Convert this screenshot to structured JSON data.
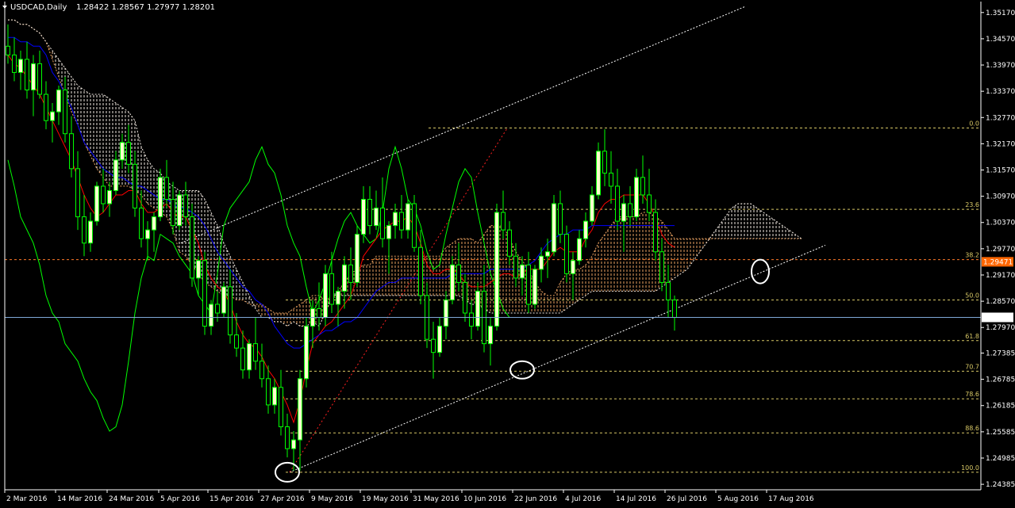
{
  "header": {
    "symbol": "USDCAD,Daily",
    "ohlc": "1.28422 1.28567 1.27977 1.28201"
  },
  "colors": {
    "background": "#000000",
    "bull_candle": "#ffffcc",
    "bear_candle": "#000000",
    "wick": "#00ff00",
    "tenkan": "#ff0000",
    "kijun": "#0000ff",
    "chikou": "#00ff00",
    "cloud": "#e8a060",
    "fib_line": "#d8c866",
    "trendline": "#ffffff",
    "current_price_bg": "#ffffff",
    "marker_price_bg": "#ff6600"
  },
  "chart_data": {
    "type": "candlestick",
    "title": "USDCAD,Daily",
    "price_axis_ticks": [
      "1.35170",
      "1.34570",
      "1.33970",
      "1.33370",
      "1.32770",
      "1.32170",
      "1.31570",
      "1.30970",
      "1.30370",
      "1.29770",
      "1.29170",
      "1.28570",
      "1.27970",
      "1.27385",
      "1.26785",
      "1.26185",
      "1.25585",
      "1.24985",
      "1.24385"
    ],
    "date_axis_ticks": [
      "2 Mar 2016",
      "14 Mar 2016",
      "24 Mar 2016",
      "5 Apr 2016",
      "15 Apr 2016",
      "27 Apr 2016",
      "9 May 2016",
      "19 May 2016",
      "31 May 2016",
      "10 Jun 2016",
      "22 Jun 2016",
      "4 Jul 2016",
      "14 Jul 2016",
      "26 Jul 2016",
      "5 Aug 2016",
      "17 Aug 2016"
    ],
    "ylim": [
      1.2426,
      1.3542
    ],
    "current_price": "1.28201",
    "marker_price": "1.29471",
    "fibonacci": {
      "high": 1.3253,
      "low": 1.2466,
      "levels": [
        {
          "label": "0.0",
          "value": 1.3253
        },
        {
          "label": "23.6",
          "value": 1.3067
        },
        {
          "label": "38.2",
          "value": 1.2952
        },
        {
          "label": "50.0",
          "value": 1.286
        },
        {
          "label": "61.8",
          "value": 1.2767
        },
        {
          "label": "70.7",
          "value": 1.2697
        },
        {
          "label": "78.6",
          "value": 1.2634
        },
        {
          "label": "88.6",
          "value": 1.2556
        },
        {
          "label": "100.0",
          "value": 1.2466
        }
      ]
    },
    "ohlc": [
      [
        1.344,
        1.349,
        1.34,
        1.342
      ],
      [
        1.342,
        1.346,
        1.336,
        1.338
      ],
      [
        1.338,
        1.343,
        1.334,
        1.341
      ],
      [
        1.341,
        1.345,
        1.332,
        1.334
      ],
      [
        1.334,
        1.342,
        1.328,
        1.34
      ],
      [
        1.34,
        1.343,
        1.332,
        1.333
      ],
      [
        1.333,
        1.336,
        1.325,
        1.327
      ],
      [
        1.327,
        1.331,
        1.322,
        1.329
      ],
      [
        1.329,
        1.335,
        1.326,
        1.334
      ],
      [
        1.334,
        1.337,
        1.322,
        1.324
      ],
      [
        1.324,
        1.328,
        1.314,
        1.316
      ],
      [
        1.316,
        1.32,
        1.302,
        1.305
      ],
      [
        1.305,
        1.31,
        1.296,
        1.299
      ],
      [
        1.299,
        1.306,
        1.297,
        1.304
      ],
      [
        1.304,
        1.313,
        1.303,
        1.312
      ],
      [
        1.312,
        1.316,
        1.306,
        1.308
      ],
      [
        1.308,
        1.313,
        1.305,
        1.311
      ],
      [
        1.311,
        1.32,
        1.31,
        1.318
      ],
      [
        1.318,
        1.324,
        1.316,
        1.322
      ],
      [
        1.322,
        1.326,
        1.315,
        1.317
      ],
      [
        1.317,
        1.32,
        1.305,
        1.307
      ],
      [
        1.307,
        1.311,
        1.298,
        1.3
      ],
      [
        1.3,
        1.304,
        1.295,
        1.302
      ],
      [
        1.302,
        1.306,
        1.297,
        1.305
      ],
      [
        1.305,
        1.316,
        1.304,
        1.314
      ],
      [
        1.314,
        1.318,
        1.307,
        1.309
      ],
      [
        1.309,
        1.313,
        1.301,
        1.303
      ],
      [
        1.303,
        1.311,
        1.302,
        1.31
      ],
      [
        1.31,
        1.313,
        1.303,
        1.305
      ],
      [
        1.305,
        1.308,
        1.289,
        1.291
      ],
      [
        1.291,
        1.296,
        1.287,
        1.295
      ],
      [
        1.295,
        1.297,
        1.278,
        1.28
      ],
      [
        1.28,
        1.286,
        1.278,
        1.285
      ],
      [
        1.285,
        1.288,
        1.281,
        1.283
      ],
      [
        1.283,
        1.29,
        1.282,
        1.289
      ],
      [
        1.289,
        1.293,
        1.276,
        1.278
      ],
      [
        1.278,
        1.283,
        1.273,
        1.275
      ],
      [
        1.275,
        1.279,
        1.268,
        1.27
      ],
      [
        1.27,
        1.277,
        1.268,
        1.276
      ],
      [
        1.276,
        1.282,
        1.27,
        1.272
      ],
      [
        1.272,
        1.276,
        1.266,
        1.268
      ],
      [
        1.268,
        1.271,
        1.26,
        1.262
      ],
      [
        1.262,
        1.268,
        1.26,
        1.266
      ],
      [
        1.266,
        1.27,
        1.255,
        1.257
      ],
      [
        1.257,
        1.26,
        1.25,
        1.252
      ],
      [
        1.252,
        1.256,
        1.247,
        1.254
      ],
      [
        1.254,
        1.27,
        1.247,
        1.268
      ],
      [
        1.268,
        1.282,
        1.266,
        1.28
      ],
      [
        1.28,
        1.286,
        1.275,
        1.284
      ],
      [
        1.284,
        1.29,
        1.279,
        1.282
      ],
      [
        1.282,
        1.294,
        1.28,
        1.292
      ],
      [
        1.292,
        1.297,
        1.283,
        1.285
      ],
      [
        1.285,
        1.289,
        1.28,
        1.288
      ],
      [
        1.288,
        1.296,
        1.284,
        1.294
      ],
      [
        1.294,
        1.298,
        1.286,
        1.29
      ],
      [
        1.29,
        1.303,
        1.289,
        1.301
      ],
      [
        1.301,
        1.312,
        1.299,
        1.309
      ],
      [
        1.309,
        1.312,
        1.301,
        1.303
      ],
      [
        1.303,
        1.311,
        1.302,
        1.307
      ],
      [
        1.307,
        1.314,
        1.298,
        1.3
      ],
      [
        1.3,
        1.304,
        1.292,
        1.303
      ],
      [
        1.303,
        1.308,
        1.3,
        1.306
      ],
      [
        1.306,
        1.31,
        1.3,
        1.302
      ],
      [
        1.302,
        1.309,
        1.3,
        1.308
      ],
      [
        1.308,
        1.31,
        1.297,
        1.298
      ],
      [
        1.298,
        1.302,
        1.285,
        1.287
      ],
      [
        1.287,
        1.29,
        1.275,
        1.277
      ],
      [
        1.277,
        1.281,
        1.268,
        1.274
      ],
      [
        1.274,
        1.282,
        1.273,
        1.28
      ],
      [
        1.28,
        1.288,
        1.277,
        1.286
      ],
      [
        1.286,
        1.296,
        1.285,
        1.294
      ],
      [
        1.294,
        1.299,
        1.288,
        1.29
      ],
      [
        1.29,
        1.292,
        1.281,
        1.283
      ],
      [
        1.283,
        1.286,
        1.277,
        1.28
      ],
      [
        1.28,
        1.29,
        1.279,
        1.288
      ],
      [
        1.288,
        1.294,
        1.274,
        1.276
      ],
      [
        1.276,
        1.282,
        1.271,
        1.28
      ],
      [
        1.28,
        1.308,
        1.279,
        1.306
      ],
      [
        1.306,
        1.311,
        1.3,
        1.302
      ],
      [
        1.302,
        1.304,
        1.294,
        1.296
      ],
      [
        1.296,
        1.299,
        1.289,
        1.291
      ],
      [
        1.291,
        1.296,
        1.287,
        1.294
      ],
      [
        1.294,
        1.297,
        1.283,
        1.285
      ],
      [
        1.285,
        1.294,
        1.284,
        1.293
      ],
      [
        1.293,
        1.298,
        1.29,
        1.296
      ],
      [
        1.296,
        1.3,
        1.291,
        1.297
      ],
      [
        1.297,
        1.31,
        1.296,
        1.308
      ],
      [
        1.308,
        1.311,
        1.299,
        1.301
      ],
      [
        1.301,
        1.303,
        1.29,
        1.292
      ],
      [
        1.292,
        1.297,
        1.286,
        1.295
      ],
      [
        1.295,
        1.302,
        1.294,
        1.3
      ],
      [
        1.3,
        1.306,
        1.298,
        1.304
      ],
      [
        1.304,
        1.312,
        1.303,
        1.31
      ],
      [
        1.31,
        1.322,
        1.309,
        1.32
      ],
      [
        1.32,
        1.325,
        1.312,
        1.315
      ],
      [
        1.315,
        1.32,
        1.308,
        1.312
      ],
      [
        1.312,
        1.316,
        1.302,
        1.304
      ],
      [
        1.304,
        1.31,
        1.297,
        1.308
      ],
      [
        1.308,
        1.312,
        1.303,
        1.305
      ],
      [
        1.305,
        1.316,
        1.304,
        1.314
      ],
      [
        1.314,
        1.319,
        1.308,
        1.31
      ],
      [
        1.31,
        1.316,
        1.304,
        1.306
      ],
      [
        1.306,
        1.309,
        1.295,
        1.297
      ],
      [
        1.297,
        1.3,
        1.288,
        1.29
      ],
      [
        1.29,
        1.294,
        1.282,
        1.286
      ],
      [
        1.286,
        1.287,
        1.279,
        1.282
      ]
    ],
    "tenkan_sen": [
      1.342,
      1.34,
      1.339,
      1.337,
      1.335,
      1.333,
      1.33,
      1.327,
      1.324,
      1.321,
      1.318,
      1.314,
      1.31,
      1.307,
      1.305,
      1.306,
      1.308,
      1.31,
      1.31,
      1.311,
      1.311,
      1.308,
      1.306,
      1.306,
      1.307,
      1.308,
      1.306,
      1.305,
      1.305,
      1.302,
      1.299,
      1.294,
      1.291,
      1.289,
      1.288,
      1.285,
      1.281,
      1.278,
      1.276,
      1.275,
      1.273,
      1.27,
      1.268,
      1.265,
      1.262,
      1.258,
      1.263,
      1.27,
      1.276,
      1.278,
      1.28,
      1.281,
      1.283,
      1.285,
      1.287,
      1.291,
      1.296,
      1.298,
      1.3,
      1.302,
      1.303,
      1.304,
      1.304,
      1.305,
      1.303,
      1.299,
      1.294,
      1.292,
      1.292,
      1.293,
      1.293,
      1.292,
      1.29,
      1.289,
      1.289,
      1.289,
      1.29,
      1.291,
      1.292,
      1.292,
      1.291,
      1.292,
      1.293,
      1.293,
      1.293,
      1.295,
      1.297,
      1.298,
      1.297,
      1.297,
      1.297,
      1.3,
      1.302,
      1.306,
      1.308,
      1.309,
      1.309,
      1.31,
      1.31,
      1.31,
      1.31,
      1.308,
      1.305,
      1.301,
      1.299,
      1.298
    ],
    "kijun_sen": [
      1.346,
      1.346,
      1.345,
      1.345,
      1.344,
      1.344,
      1.342,
      1.338,
      1.336,
      1.333,
      1.33,
      1.326,
      1.322,
      1.32,
      1.318,
      1.316,
      1.315,
      1.314,
      1.314,
      1.313,
      1.312,
      1.312,
      1.311,
      1.31,
      1.309,
      1.309,
      1.308,
      1.307,
      1.307,
      1.306,
      1.305,
      1.303,
      1.3,
      1.297,
      1.295,
      1.293,
      1.291,
      1.289,
      1.288,
      1.286,
      1.285,
      1.283,
      1.28,
      1.278,
      1.276,
      1.275,
      1.275,
      1.276,
      1.277,
      1.278,
      1.279,
      1.279,
      1.28,
      1.281,
      1.281,
      1.282,
      1.284,
      1.286,
      1.288,
      1.289,
      1.29,
      1.29,
      1.291,
      1.291,
      1.291,
      1.291,
      1.291,
      1.291,
      1.291,
      1.291,
      1.292,
      1.292,
      1.292,
      1.292,
      1.292,
      1.292,
      1.293,
      1.293,
      1.293,
      1.293,
      1.293,
      1.293,
      1.294,
      1.295,
      1.297,
      1.299,
      1.3,
      1.301,
      1.301,
      1.302,
      1.302,
      1.302,
      1.303,
      1.303,
      1.303,
      1.303,
      1.303,
      1.303,
      1.303,
      1.303,
      1.303,
      1.303,
      1.303,
      1.303,
      1.303,
      1.303
    ],
    "chikou_span": [
      1.318,
      1.312,
      1.305,
      1.302,
      1.299,
      1.294,
      1.287,
      1.283,
      1.281,
      1.276,
      1.274,
      1.272,
      1.268,
      1.265,
      1.263,
      1.259,
      1.256,
      1.257,
      1.262,
      1.272,
      1.283,
      1.291,
      1.296,
      1.295,
      1.301,
      1.3,
      1.299,
      1.296,
      1.294,
      1.292,
      1.287,
      1.285,
      1.283,
      1.292,
      1.303,
      1.307,
      1.309,
      1.311,
      1.313,
      1.318,
      1.321,
      1.317,
      1.315,
      1.31,
      1.303,
      1.299,
      1.296,
      1.289,
      1.283,
      1.286,
      1.29,
      1.295,
      1.3,
      1.304,
      1.306,
      1.303,
      1.301,
      1.299,
      1.3,
      1.306,
      1.316,
      1.321,
      1.316,
      1.309,
      1.307,
      1.303,
      1.297,
      1.293,
      1.294,
      1.301,
      1.307,
      1.313,
      1.316,
      1.314,
      1.306,
      1.299,
      1.292,
      1.288,
      1.284,
      1.282
    ],
    "cloud": {
      "span_a": [
        1.35,
        1.35,
        1.349,
        1.349,
        1.348,
        1.347,
        1.345,
        1.341,
        1.337,
        1.333,
        1.329,
        1.326,
        1.322,
        1.319,
        1.316,
        1.314,
        1.312,
        1.312,
        1.312,
        1.312,
        1.311,
        1.31,
        1.308,
        1.307,
        1.306,
        1.305,
        1.302,
        1.297,
        1.296,
        1.294,
        1.292,
        1.29,
        1.289,
        1.288,
        1.287,
        1.287,
        1.286,
        1.286,
        1.285,
        1.285,
        1.285,
        1.284,
        1.283,
        1.283,
        1.283,
        1.284,
        1.285,
        1.286,
        1.287,
        1.287,
        1.286,
        1.286,
        1.288,
        1.29,
        1.292,
        1.293,
        1.294,
        1.294,
        1.296,
        1.296,
        1.296,
        1.296,
        1.296,
        1.296,
        1.296,
        1.296,
        1.296,
        1.296,
        1.296,
        1.298,
        1.299,
        1.3,
        1.3,
        1.3,
        1.299,
        1.301,
        1.303,
        1.303,
        1.303,
        1.3,
        1.297,
        1.295,
        1.293,
        1.29,
        1.288,
        1.287,
        1.287,
        1.29,
        1.292,
        1.293,
        1.293,
        1.294,
        1.296,
        1.299,
        1.301,
        1.303,
        1.305,
        1.305,
        1.305,
        1.305,
        1.306,
        1.306,
        1.305,
        1.304,
        1.302,
        1.3,
        1.3,
        1.3,
        1.3,
        1.3,
        1.3,
        1.3,
        1.3,
        1.3,
        1.3,
        1.3,
        1.3,
        1.3,
        1.3,
        1.3,
        1.3,
        1.3,
        1.3,
        1.3,
        1.3,
        1.3
      ],
      "span_b": [
        1.35,
        1.35,
        1.349,
        1.349,
        1.348,
        1.347,
        1.345,
        1.343,
        1.341,
        1.339,
        1.337,
        1.335,
        1.334,
        1.333,
        1.333,
        1.333,
        1.332,
        1.331,
        1.33,
        1.329,
        1.327,
        1.321,
        1.318,
        1.316,
        1.315,
        1.313,
        1.312,
        1.311,
        1.311,
        1.311,
        1.311,
        1.309,
        1.306,
        1.303,
        1.299,
        1.296,
        1.293,
        1.29,
        1.287,
        1.284,
        1.282,
        1.282,
        1.281,
        1.281,
        1.28,
        1.281,
        1.28,
        1.28,
        1.281,
        1.28,
        1.283,
        1.287,
        1.287,
        1.287,
        1.287,
        1.287,
        1.287,
        1.287,
        1.287,
        1.287,
        1.287,
        1.287,
        1.287,
        1.287,
        1.287,
        1.287,
        1.287,
        1.287,
        1.287,
        1.287,
        1.287,
        1.287,
        1.286,
        1.285,
        1.285,
        1.284,
        1.283,
        1.283,
        1.283,
        1.283,
        1.283,
        1.283,
        1.283,
        1.283,
        1.283,
        1.283,
        1.283,
        1.283,
        1.284,
        1.285,
        1.286,
        1.287,
        1.288,
        1.288,
        1.288,
        1.288,
        1.288,
        1.288,
        1.288,
        1.288,
        1.288,
        1.288,
        1.288,
        1.289,
        1.29,
        1.291,
        1.292,
        1.293,
        1.295,
        1.297,
        1.299,
        1.301,
        1.303,
        1.305,
        1.307,
        1.308,
        1.308,
        1.308,
        1.307,
        1.306,
        1.305,
        1.304,
        1.303,
        1.302,
        1.301,
        1.3
      ]
    }
  }
}
